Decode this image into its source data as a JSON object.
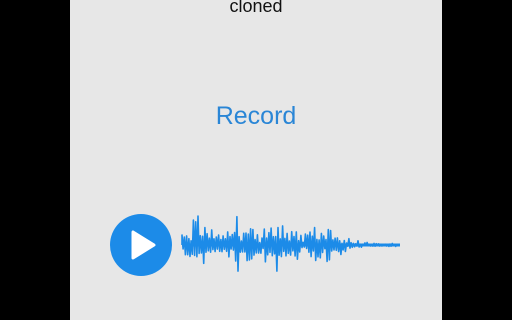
{
  "status": {
    "text": "cloned"
  },
  "record": {
    "label": "Record"
  },
  "player": {
    "play_icon": "play-icon",
    "waveform_icon": "waveform-icon",
    "accent_color": "#1c8be8"
  },
  "colors": {
    "background": "#e7e7e7",
    "record_text": "#2a86d6",
    "frame": "#000000"
  }
}
